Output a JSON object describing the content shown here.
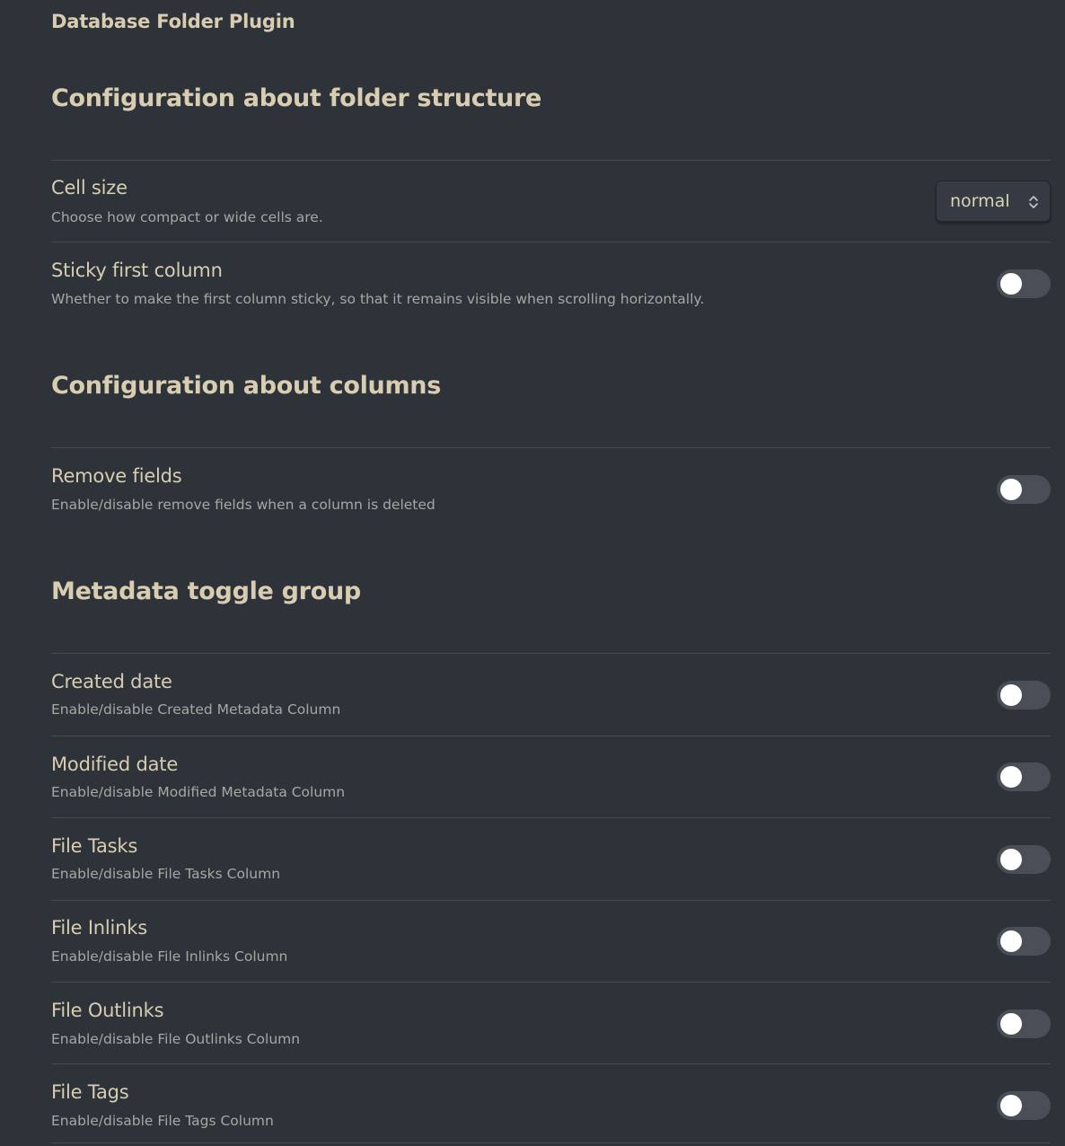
{
  "plugin_title": "Database Folder Plugin",
  "sections": {
    "folder_structure": {
      "heading": "Configuration about folder structure",
      "cell_size": {
        "name": "Cell size",
        "desc": "Choose how compact or wide cells are.",
        "value": "normal"
      },
      "sticky_first_column": {
        "name": "Sticky first column",
        "desc": "Whether to make the first column sticky, so that it remains visible when scrolling horizontally.",
        "enabled": false
      }
    },
    "columns": {
      "heading": "Configuration about columns",
      "remove_fields": {
        "name": "Remove fields",
        "desc": "Enable/disable remove fields when a column is deleted",
        "enabled": false
      }
    },
    "metadata": {
      "heading": "Metadata toggle group",
      "created_date": {
        "name": "Created date",
        "desc": "Enable/disable Created Metadata Column",
        "enabled": false
      },
      "modified_date": {
        "name": "Modified date",
        "desc": "Enable/disable Modified Metadata Column",
        "enabled": false
      },
      "file_tasks": {
        "name": "File Tasks",
        "desc": "Enable/disable File Tasks Column",
        "enabled": false
      },
      "file_inlinks": {
        "name": "File Inlinks",
        "desc": "Enable/disable File Inlinks Column",
        "enabled": false
      },
      "file_outlinks": {
        "name": "File Outlinks",
        "desc": "Enable/disable File Outlinks Column",
        "enabled": false
      },
      "file_tags": {
        "name": "File Tags",
        "desc": "Enable/disable File Tags Column",
        "enabled": false
      }
    }
  },
  "colors": {
    "background": "#2e3239",
    "heading": "#d8cdb1",
    "description": "#a8a8a3",
    "toggle_off": "#4a4f57",
    "divider": "#444a52"
  }
}
